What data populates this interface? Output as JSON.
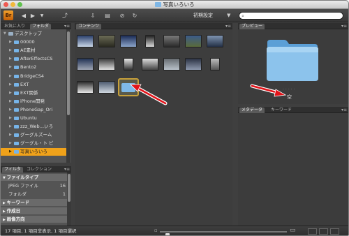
{
  "window": {
    "title": "写真いろいろ"
  },
  "toolbar": {
    "app_logo": "Br",
    "workspace": "初期設定",
    "search_placeholder": "",
    "search_icon": "⌕"
  },
  "folders": {
    "tabs": [
      "お気に入り",
      "フォルダ"
    ],
    "items": [
      {
        "label": "デスクトップ",
        "level": 0,
        "expanded": true
      },
      {
        "label": "00000",
        "level": 1
      },
      {
        "label": "AE素材",
        "level": 1
      },
      {
        "label": "AfterEffectsCS",
        "level": 1
      },
      {
        "label": "Bento2",
        "level": 1
      },
      {
        "label": "BridgeCS4",
        "level": 1
      },
      {
        "label": "EXT",
        "level": 1
      },
      {
        "label": "EXT関係",
        "level": 1
      },
      {
        "label": "iPhone開発",
        "level": 1
      },
      {
        "label": "PhoneGap_Ori",
        "level": 1
      },
      {
        "label": "Ubuntu",
        "level": 1
      },
      {
        "label": "zzz_Web…いろ",
        "level": 1
      },
      {
        "label": "グーグルズーム",
        "level": 1
      },
      {
        "label": "グーグル・ト ビ",
        "level": 1
      },
      {
        "label": "写真いろいろ",
        "level": 1,
        "selected": true
      }
    ]
  },
  "filter": {
    "tabs": [
      "フィルタ",
      "コレクション"
    ],
    "rows": [
      {
        "label": "ファイルタイプ",
        "type": "head",
        "expanded": true
      },
      {
        "label": "JPEG ファイル",
        "count": "16",
        "type": "item"
      },
      {
        "label": "フォルダ",
        "count": "1",
        "type": "item"
      },
      {
        "label": "キーワード",
        "type": "head"
      },
      {
        "label": "作成日",
        "type": "head"
      },
      {
        "label": "画像方向",
        "type": "head"
      }
    ]
  },
  "content": {
    "tab": "コンテンツ",
    "thumbnails": [
      {
        "kind": "photo",
        "tone": [
          "#2a3f6b",
          "#c9d6e8"
        ]
      },
      {
        "kind": "photo",
        "tone": [
          "#6b6b55",
          "#2a2a20"
        ]
      },
      {
        "kind": "photo",
        "tone": [
          "#1b2b55",
          "#8ba4c9"
        ]
      },
      {
        "kind": "photo",
        "tone": [
          "#202020",
          "#d9d9d9"
        ]
      },
      {
        "kind": "photo",
        "tone": [
          "#7a7a7a",
          "#2a2a2a"
        ]
      },
      {
        "kind": "photo",
        "tone": [
          "#3b5a8a",
          "#5a6b3b"
        ]
      },
      {
        "kind": "photo",
        "tone": [
          "#7e93b0",
          "#233046"
        ]
      },
      {
        "kind": "photo",
        "tone": [
          "#223355",
          "#a0a6b4"
        ]
      },
      {
        "kind": "photo",
        "tone": [
          "#3b3b3b",
          "#e1e1e1"
        ]
      },
      {
        "kind": "photo",
        "tone": [
          "#e8e8e8",
          "#333333"
        ]
      },
      {
        "kind": "photo",
        "tone": [
          "#dddddd",
          "#444444"
        ]
      },
      {
        "kind": "photo",
        "tone": [
          "#666b70",
          "#b9c1c9"
        ]
      },
      {
        "kind": "photo",
        "tone": [
          "#2c3344",
          "#8d98ad"
        ]
      },
      {
        "kind": "photo",
        "tone": [
          "#bdbdbd",
          "#555555"
        ]
      },
      {
        "kind": "photo",
        "tone": [
          "#2a2a2a",
          "#e7e7e7"
        ]
      },
      {
        "kind": "photo",
        "tone": [
          "#4e5b70",
          "#cfd7e0"
        ]
      },
      {
        "kind": "folder",
        "selected": true
      }
    ]
  },
  "preview": {
    "tab": "プレビュー",
    "caption": "空"
  },
  "meta": {
    "tabs": [
      "メタデータ",
      "キーワード"
    ]
  },
  "status": {
    "text": "17 項目, 1 項目非表示, 1 項目選択",
    "zoom": 0.06
  },
  "colors": {
    "accent": "#f0a21a",
    "selection": "#c8a13a",
    "arrow": "#e2141a",
    "folder": "#7fb9e8"
  }
}
